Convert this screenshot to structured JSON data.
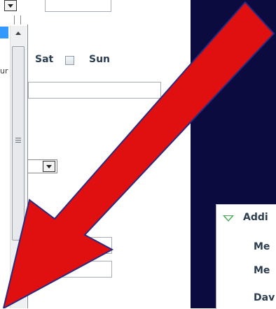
{
  "schedule": {
    "sat_label": "Sat",
    "sun_label": "Sun"
  },
  "list_fragment": "ur",
  "help_icon_glyph": "?",
  "section": {
    "title": "Addi",
    "rows": [
      "Me",
      "Me",
      "Dav"
    ]
  },
  "colors": {
    "annotation_arrow": "#e01010",
    "dark_background": "#0b0b3f",
    "selection": "#3399ff",
    "help_icon": "#3b7fd1",
    "expand_icon": "#4aa85a"
  },
  "icons": {
    "dropdown": "chevron-down-icon",
    "help": "help-icon",
    "expand": "triangle-down-icon",
    "annotation": "arrow-icon"
  }
}
